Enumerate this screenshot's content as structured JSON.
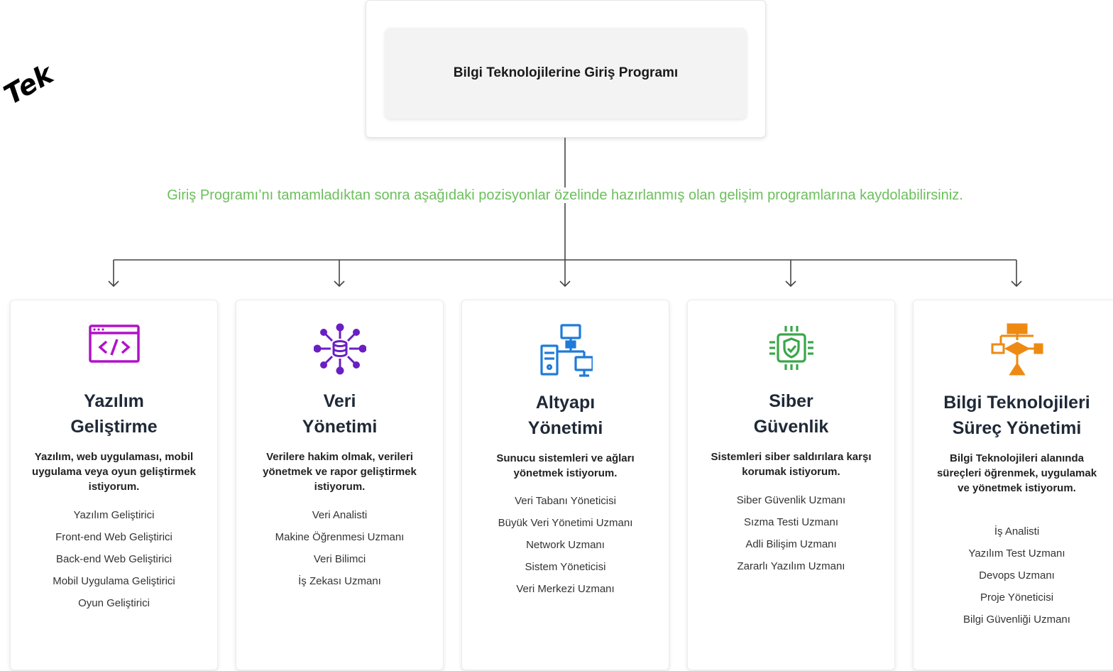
{
  "decoration": {
    "corner_text": "Tek"
  },
  "top": {
    "title": "Bilgi Teknolojilerine Giriş Programı"
  },
  "note": "Giriş Programı’nı tamamladıktan sonra aşağıdaki pozisyonlar özelinde hazırlanmış olan gelişim programlarına kaydolabilirsiniz.",
  "colors": {
    "note": "#6cbf5c",
    "line": "#444444",
    "software": "#b012c8",
    "data": "#6a1fc2",
    "infra": "#1f7bd8",
    "security": "#3aa64a",
    "process": "#ee8a12"
  },
  "cards": [
    {
      "icon": "code-window-icon",
      "title": "Yazılım\nGeliştirme",
      "desc": "Yazılım, web uygulaması, mobil uygulama veya oyun geliştirmek istiyorum.",
      "items": [
        "Yazılım Geliştirici",
        "Front-end Web Geliştirici",
        "Back-end Web Geliştirici",
        "Mobil Uygulama Geliştirici",
        "Oyun Geliştirici"
      ]
    },
    {
      "icon": "database-network-icon",
      "title": "Veri\nYönetimi",
      "desc": "Verilere hakim olmak, verileri yönetmek ve rapor geliştirmek istiyorum.",
      "items": [
        "Veri Analisti",
        "Makine Öğrenmesi Uzmanı",
        "Veri Bilimci",
        "İş Zekası Uzmanı"
      ]
    },
    {
      "icon": "server-network-icon",
      "title": "Altyapı\nYönetimi",
      "desc": "Sunucu sistemleri ve ağları yönetmek istiyorum.",
      "items": [
        "Veri Tabanı Yöneticisi",
        "Büyük Veri Yönetimi Uzmanı",
        "Network Uzmanı",
        "Sistem Yöneticisi",
        "Veri Merkezi Uzmanı"
      ]
    },
    {
      "icon": "shield-chip-icon",
      "title": "Siber\nGüvenlik",
      "desc": "Sistemleri siber saldırılara karşı korumak istiyorum.",
      "items": [
        "Siber Güvenlik Uzmanı",
        "Sızma Testi Uzmanı",
        "Adli Bilişim Uzmanı",
        "Zararlı Yazılım Uzmanı"
      ]
    },
    {
      "icon": "process-flow-icon",
      "title": "Bilgi Teknolojileri\nSüreç Yönetimi",
      "desc": "Bilgi Teknolojileri alanında süreçleri öğrenmek, uygulamak ve yönetmek istiyorum.",
      "items": [
        "İş Analisti",
        "Yazılım Test Uzmanı",
        "Devops Uzmanı",
        "Proje Yöneticisi",
        "Bilgi Güvenliği Uzmanı"
      ]
    }
  ]
}
